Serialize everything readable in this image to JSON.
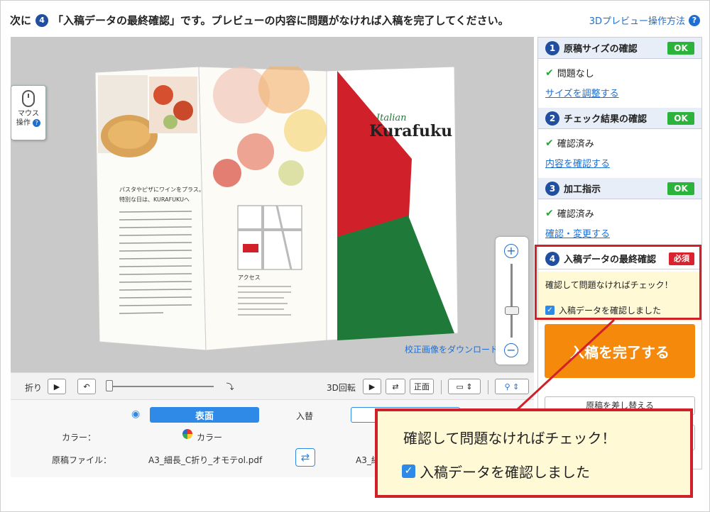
{
  "header": {
    "prefix": "次に",
    "step_number": "4",
    "instruction": "「入稿データの最終確認」です。プレビューの内容に問題がなければ入稿を完了してください。",
    "help_link": "3Dプレビュー操作方法",
    "help_icon": "?"
  },
  "preview": {
    "mouse_label_1": "マウス",
    "mouse_label_2": "操作",
    "download_link": "校正画像をダウンロード",
    "brochure_title_small": "Italian",
    "brochure_title": "Kurafuku",
    "brochure_heading_1": "パスタやピザにワインをプラス。",
    "brochure_heading_2": "特別な日は、KURAFUKUへ",
    "access_label": "アクセス",
    "colors": {
      "red": "#d0202a",
      "green": "#1f7a3a"
    }
  },
  "controls": {
    "fold_label": "折り",
    "rotate_label": "3D回転",
    "front_button": "正面"
  },
  "settings": {
    "front_tab": "表面",
    "swap_label": "入替",
    "color_label": "カラー：",
    "color_value": "カラー",
    "file_label": "原稿ファイル：",
    "file_front": "A3_細長_C折り_オモテol.pdf",
    "file_back": "A3_細"
  },
  "steps": {
    "s1": {
      "number": "1",
      "title": "原稿サイズの確認",
      "badge": "OK",
      "status": "問題なし",
      "link": "サイズを調整する"
    },
    "s2": {
      "number": "2",
      "title": "チェック結果の確認",
      "badge": "OK",
      "status": "確認済み",
      "link": "内容を確認する"
    },
    "s3": {
      "number": "3",
      "title": "加工指示",
      "badge": "OK",
      "status": "確認済み",
      "link": "確認・変更する"
    },
    "s4": {
      "number": "4",
      "title": "入稿データの最終確認",
      "badge": "必須",
      "instruction": "確認して問題なければチェック！",
      "checkbox": "入稿データを確認しました"
    },
    "complete_button": "入稿を完了する",
    "partial_below": "原稿を差し替える"
  },
  "callout": {
    "line1": "確認して問題なければチェック！",
    "line2": "入稿データを確認しました"
  }
}
